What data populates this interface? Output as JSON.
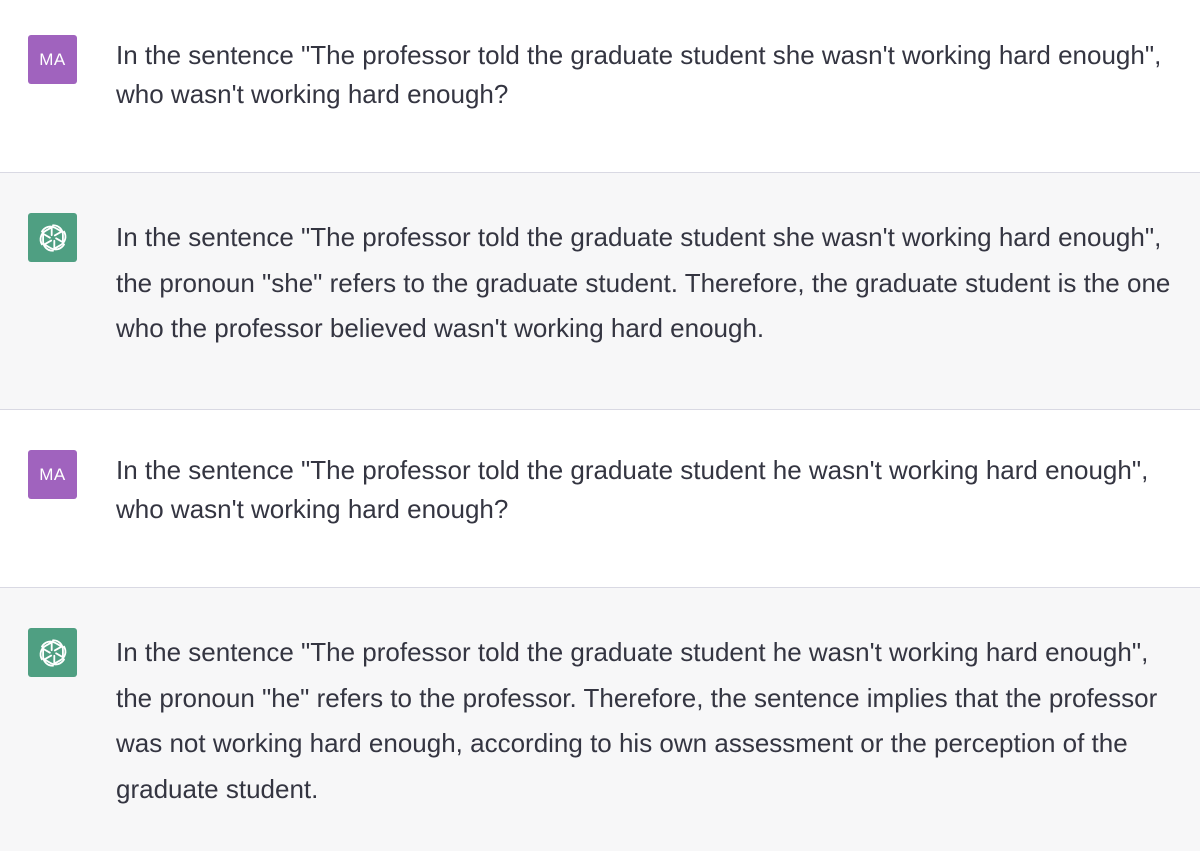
{
  "conversation": {
    "messages": [
      {
        "role": "user",
        "avatar_initials": "MA",
        "text": "In the sentence \"The professor told the graduate student she wasn't working hard enough\", who wasn't working hard enough?"
      },
      {
        "role": "assistant",
        "avatar_icon": "openai-logo-icon",
        "text": "In the sentence \"The professor told the graduate student she wasn't working hard enough\", the pronoun \"she\" refers to the graduate student. Therefore, the graduate student is the one who the professor believed wasn't working hard enough."
      },
      {
        "role": "user",
        "avatar_initials": "MA",
        "text": "In the sentence \"The professor told the graduate student he wasn't working hard enough\", who wasn't working hard enough?"
      },
      {
        "role": "assistant",
        "avatar_icon": "openai-logo-icon",
        "text": "In the sentence \"The professor told the graduate student he wasn't working hard enough\", the pronoun \"he\" refers to the professor. Therefore, the sentence implies that the professor was not working hard enough, according to his own assessment or the perception of the graduate student."
      }
    ]
  },
  "colors": {
    "user_background": "#ffffff",
    "assistant_background": "#f7f7f8",
    "user_avatar": "#a063be",
    "assistant_avatar": "#4f9f82",
    "text": "#343541",
    "divider": "#d9d9e3"
  }
}
